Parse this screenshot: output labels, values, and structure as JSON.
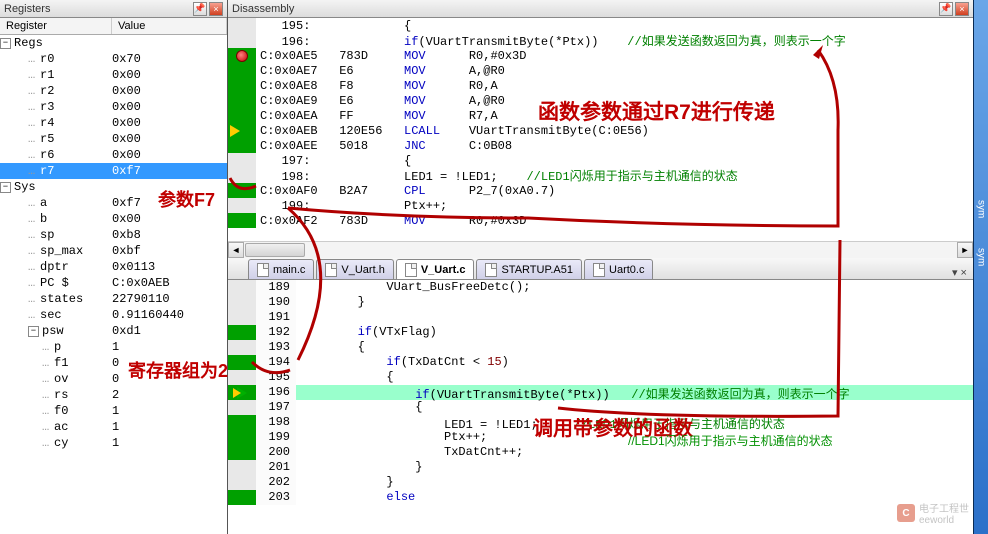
{
  "panels": {
    "registers_title": "Registers",
    "disasm_title": "Disassembly"
  },
  "reg_table": {
    "col_name": "Register",
    "col_value": "Value"
  },
  "registers": {
    "groups": [
      {
        "label": "Regs",
        "items": [
          {
            "name": "r0",
            "value": "0x70"
          },
          {
            "name": "r1",
            "value": "0x00"
          },
          {
            "name": "r2",
            "value": "0x00"
          },
          {
            "name": "r3",
            "value": "0x00"
          },
          {
            "name": "r4",
            "value": "0x00"
          },
          {
            "name": "r5",
            "value": "0x00"
          },
          {
            "name": "r6",
            "value": "0x00"
          },
          {
            "name": "r7",
            "value": "0xf7",
            "selected": true
          }
        ]
      },
      {
        "label": "Sys",
        "items": [
          {
            "name": "a",
            "value": "0xf7"
          },
          {
            "name": "b",
            "value": "0x00"
          },
          {
            "name": "sp",
            "value": "0xb8"
          },
          {
            "name": "sp_max",
            "value": "0xbf"
          },
          {
            "name": "dptr",
            "value": "0x0113"
          },
          {
            "name": "PC  $",
            "value": "C:0x0AEB"
          },
          {
            "name": "states",
            "value": "22790110"
          },
          {
            "name": "sec",
            "value": "0.91160440"
          },
          {
            "name": "psw",
            "value": "0xd1",
            "expandable": true,
            "children": [
              {
                "name": "p",
                "value": "1"
              },
              {
                "name": "f1",
                "value": "0"
              },
              {
                "name": "ov",
                "value": "0"
              },
              {
                "name": "rs",
                "value": "2"
              },
              {
                "name": "f0",
                "value": "1"
              },
              {
                "name": "ac",
                "value": "1"
              },
              {
                "name": "cy",
                "value": "1"
              }
            ]
          }
        ]
      }
    ]
  },
  "disasm": {
    "lines": [
      {
        "src": true,
        "ln": "195:",
        "text": "{"
      },
      {
        "src": true,
        "ln": "196:",
        "kw": "if",
        "text": "(VUartTransmitByte(*Ptx))",
        "comment": "//如果发送函数返回为真，则表示一个字"
      },
      {
        "margin": "green",
        "bp": true,
        "addr": "C:0x0AE5",
        "opcode": "783D",
        "mnem": "MOV",
        "operand": "R0,#0x3D"
      },
      {
        "margin": "green",
        "addr": "C:0x0AE7",
        "opcode": "E6",
        "mnem": "MOV",
        "operand": "A,@R0"
      },
      {
        "margin": "green",
        "addr": "C:0x0AE8",
        "opcode": "F8",
        "mnem": "MOV",
        "operand": "R0,A"
      },
      {
        "margin": "green",
        "addr": "C:0x0AE9",
        "opcode": "E6",
        "mnem": "MOV",
        "operand": "A,@R0"
      },
      {
        "margin": "green",
        "addr": "C:0x0AEA",
        "opcode": "FF",
        "mnem": "MOV",
        "operand": "R7,A"
      },
      {
        "margin": "green",
        "pc": true,
        "addr": "C:0x0AEB",
        "opcode": "120E56",
        "mnem": "LCALL",
        "operand": "VUartTransmitByte(C:0E56)"
      },
      {
        "margin": "green",
        "addr": "C:0x0AEE",
        "opcode": "5018",
        "mnem": "JNC",
        "operand": "C:0B08"
      },
      {
        "src": true,
        "ln": "197:",
        "text": "{"
      },
      {
        "src": true,
        "ln": "198:",
        "text": "LED1 = !LED1;",
        "comment": "//LED1闪烁用于指示与主机通信的状态"
      },
      {
        "margin": "green",
        "addr": "C:0x0AF0",
        "opcode": "B2A7",
        "mnem": "CPL",
        "operand": "P2_7(0xA0.7)"
      },
      {
        "src": true,
        "ln": "199:",
        "text": "Ptx++;"
      },
      {
        "margin": "green",
        "addr": "C:0x0AF2",
        "opcode": "783D",
        "mnem": "MOV",
        "operand": "R0,#0x3D"
      }
    ]
  },
  "tabs": [
    {
      "label": "main.c"
    },
    {
      "label": "V_Uart.h"
    },
    {
      "label": "V_Uart.c",
      "active": true
    },
    {
      "label": "STARTUP.A51"
    },
    {
      "label": "Uart0.c"
    }
  ],
  "source": {
    "lines": [
      {
        "ln": 189,
        "text": "            VUart_BusFreeDetc();"
      },
      {
        "ln": 190,
        "text": "        }"
      },
      {
        "ln": 191,
        "text": ""
      },
      {
        "ln": 192,
        "margin": "green",
        "text_kw": "        if",
        "text_rest": "(VTxFlag)"
      },
      {
        "ln": 193,
        "text": "        {"
      },
      {
        "ln": 194,
        "margin": "green",
        "text_kw": "            if",
        "text_rest": "(TxDatCnt < ",
        "num": "15",
        "text_tail": ")"
      },
      {
        "ln": 195,
        "text": "            {"
      },
      {
        "ln": 196,
        "margin": "green",
        "pc": true,
        "active": true,
        "text_kw": "                if",
        "text_rest": "(VUartTransmitByte(*Ptx))",
        "comment": "   //如果发送函数返回为真，则表示一个字"
      },
      {
        "ln": 197,
        "text": "                {"
      },
      {
        "ln": 198,
        "margin": "green",
        "text": "                    LED1 = !LED1;",
        "comment2": "     //LED1闪烁用于指示与主机通信的状态"
      },
      {
        "ln": 199,
        "margin": "green",
        "text": "                    Ptx++;"
      },
      {
        "ln": 200,
        "margin": "green",
        "text": "                    TxDatCnt++;"
      },
      {
        "ln": 201,
        "text": "                }"
      },
      {
        "ln": 202,
        "text": "            }"
      },
      {
        "ln": 203,
        "margin": "green",
        "text_kw": "            else",
        "text_rest": ""
      }
    ]
  },
  "annotations": {
    "a1": "参数F7",
    "a2": "寄存器组为2",
    "a3": "函数参数通过R7进行传递",
    "a4": "调用带参数的函数",
    "a5": "//LED1闪烁用于指示与主机通信的状态"
  },
  "watermark": {
    "text1": "电子工程世",
    "text2": "eeworld"
  },
  "side_labels": {
    "l1": "sym",
    "l2": "sym"
  }
}
